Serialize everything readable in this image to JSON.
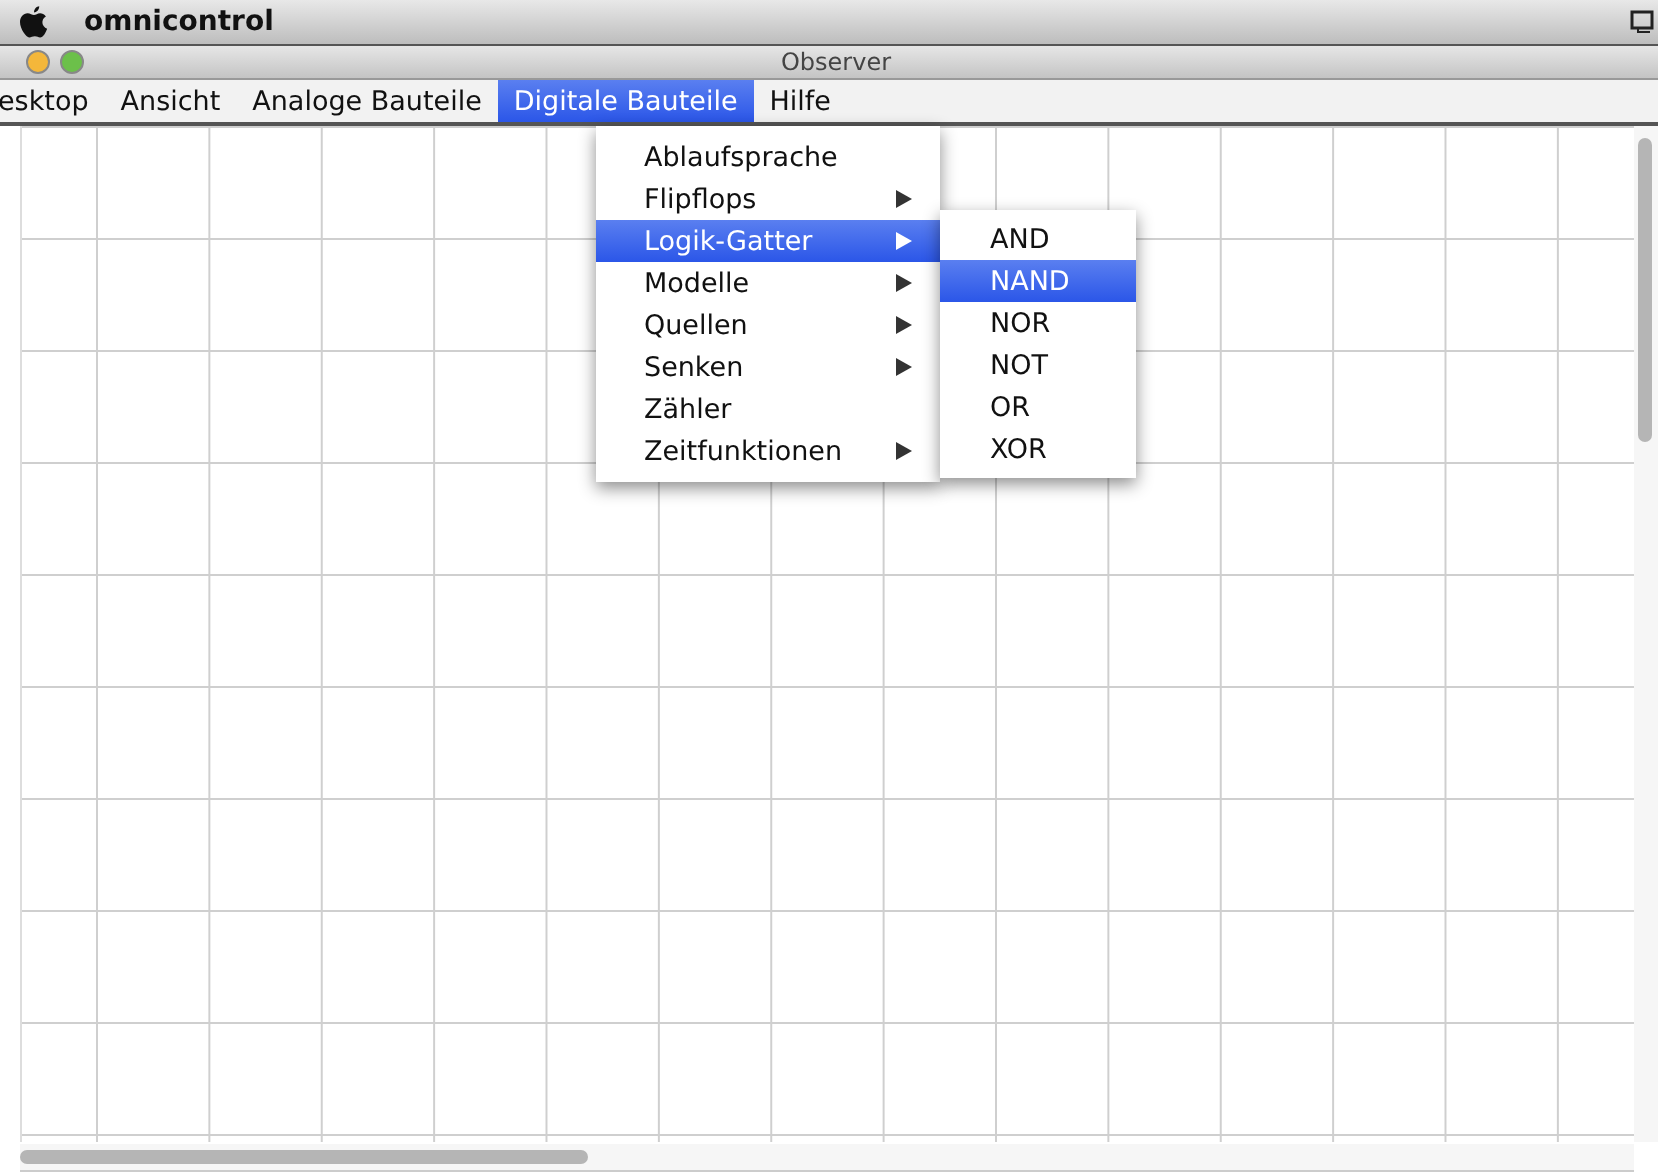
{
  "system_menu_bar": {
    "app_name": "omnicontrol"
  },
  "window": {
    "title": "Observer"
  },
  "menu_bar": [
    {
      "label": "esktop",
      "selected": false
    },
    {
      "label": "Ansicht",
      "selected": false
    },
    {
      "label": "Analoge Bauteile",
      "selected": false
    },
    {
      "label": "Digitale Bauteile",
      "selected": true
    },
    {
      "label": "Hilfe",
      "selected": false
    }
  ],
  "dropdown": [
    {
      "label": "Ablaufsprache",
      "has_submenu": false,
      "selected": false
    },
    {
      "label": "Flipflops",
      "has_submenu": true,
      "selected": false
    },
    {
      "label": "Logik-Gatter",
      "has_submenu": true,
      "selected": true
    },
    {
      "label": "Modelle",
      "has_submenu": true,
      "selected": false
    },
    {
      "label": "Quellen",
      "has_submenu": true,
      "selected": false
    },
    {
      "label": "Senken",
      "has_submenu": true,
      "selected": false
    },
    {
      "label": "Zähler",
      "has_submenu": false,
      "selected": false
    },
    {
      "label": "Zeitfunktionen",
      "has_submenu": true,
      "selected": false
    }
  ],
  "submenu": [
    {
      "label": "AND",
      "selected": false
    },
    {
      "label": "NAND",
      "selected": true
    },
    {
      "label": "NOR",
      "selected": false
    },
    {
      "label": "NOT",
      "selected": false
    },
    {
      "label": "OR",
      "selected": false
    },
    {
      "label": "XOR",
      "selected": false
    }
  ]
}
